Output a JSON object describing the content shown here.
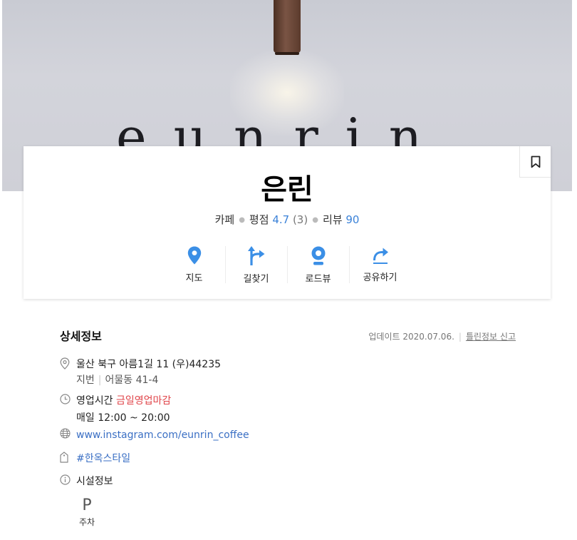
{
  "hero": {
    "sign_text": "eunrin"
  },
  "place": {
    "name": "은린",
    "category": "카페",
    "rating_label": "평점",
    "rating": "4.7",
    "rating_count": "(3)",
    "review_label": "리뷰",
    "review_count": "90"
  },
  "actions": [
    {
      "label": "지도",
      "icon": "map-pin-icon"
    },
    {
      "label": "길찾기",
      "icon": "directions-icon"
    },
    {
      "label": "로드뷰",
      "icon": "roadview-icon"
    },
    {
      "label": "공유하기",
      "icon": "share-icon"
    }
  ],
  "details": {
    "title": "상세정보",
    "updated": "업데이트 2020.07.06.",
    "report_link": "틀린정보 신고",
    "address": "울산 북구 아름1길 11 (우)44235",
    "lot_label": "지번",
    "lot_address": "어물동 41-4",
    "hours_label": "영업시간",
    "hours_status": "금일영업마감",
    "hours_detail": "매일  12:00 ~ 20:00",
    "website": "www.instagram.com/eunrin_coffee",
    "tag": "#한옥스타일",
    "facilities_label": "시설정보",
    "facility_parking_symbol": "P",
    "facility_parking": "주차"
  },
  "colors": {
    "accent": "#3b8fe6",
    "link": "#3a6fc4",
    "closed": "#e0454a"
  }
}
